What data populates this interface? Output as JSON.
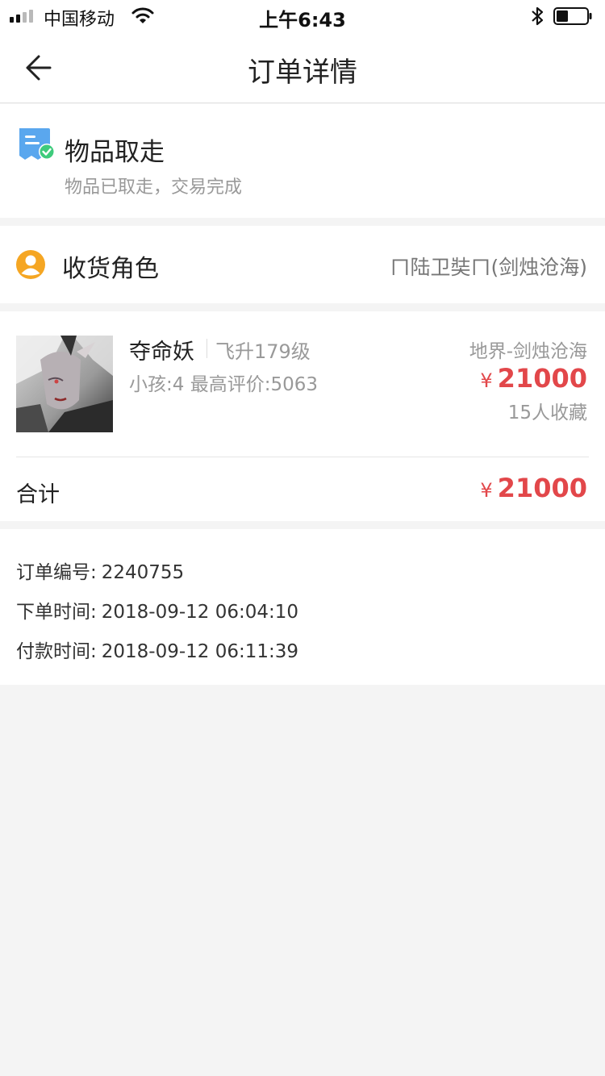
{
  "status_bar": {
    "carrier": "中国移动",
    "time": "上午6:43"
  },
  "nav": {
    "title": "订单详情"
  },
  "order_status": {
    "title": "物品取走",
    "subtitle": "物品已取走，交易完成"
  },
  "receiver": {
    "label": "收货角色",
    "value": "ㄇ陆卫奘ㄇ(剑烛沧海)"
  },
  "item": {
    "name": "夺命妖",
    "level": "飞升179级",
    "meta": "小孩:4 最高评价:5063",
    "server": "地界-剑烛沧海",
    "currency": "¥",
    "price": "21000",
    "favorites": "15人收藏"
  },
  "total": {
    "label": "合计",
    "currency": "¥",
    "value": "21000"
  },
  "order_info": {
    "order_no_label": "订单编号:",
    "order_no": "2240755",
    "order_time_label": "下单时间:",
    "order_time": "2018-09-12 06:04:10",
    "pay_time_label": "付款时间:",
    "pay_time": "2018-09-12 06:11:39"
  },
  "colors": {
    "price": "#e2474a",
    "status_icon": "#5aa7ee",
    "check": "#3ecb7c",
    "receiver_icon": "#f5a623"
  }
}
